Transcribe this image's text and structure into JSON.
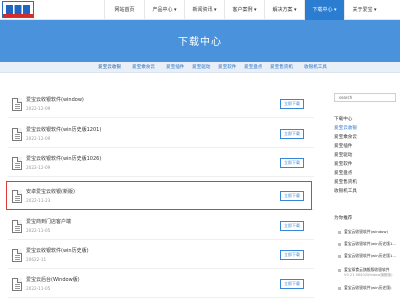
{
  "topnav": {
    "items": [
      "网站首页",
      "产品中心 ▾",
      "新闻资讯 ▾",
      "客户案例 ▾",
      "解决方案 ▾",
      "下载中心 ▾",
      "关于爱宝 ▾"
    ],
    "active_index": 5
  },
  "hero": {
    "title": "下载中心"
  },
  "subnav": {
    "items": [
      "爱宝云收银",
      "爱宝乘食云",
      "爱宝插件",
      "爱宝驱动",
      "爱宝软件",
      "爱宝盘点",
      "爱宝售货机",
      "收银机工具"
    ],
    "active_index": 0
  },
  "downloads": [
    {
      "title": "爱宝云收银软件(window)",
      "date": "2022-12-09",
      "button": "立即下载"
    },
    {
      "title": "爱宝云收银软件(win历史版1201)",
      "date": "2022-12-09",
      "button": "立即下载"
    },
    {
      "title": "爱宝云收银软件(win历史版1026)",
      "date": "2022-12-09",
      "button": "立即下载"
    },
    {
      "title": "安卓爱宝云收银(新版)",
      "date": "2022-11-23",
      "button": "立即下载"
    },
    {
      "title": "爱宝商到门店客户端",
      "date": "2022-11-05",
      "button": "立即下载"
    },
    {
      "title": "爱宝云收银软件(win历史版)",
      "date": "20622-11",
      "button": "立即下载"
    },
    {
      "title": "爱宝云后台(Window版)",
      "date": "2022-11-05",
      "button": "立即下载"
    }
  ],
  "sidebar": {
    "search_placeholder": "search",
    "heading": "下载中心",
    "links": [
      "爱宝云收银",
      "爱宝乘食云",
      "爱宝插件",
      "爱宝驱动",
      "爱宝软件",
      "爱宝盘点",
      "爱宝售货机",
      "收银机工具"
    ],
    "active_index": 0,
    "recommend_heading": "为你推荐",
    "recommend": [
      {
        "title": "爱宝云收银软件(window)",
        "date": ""
      },
      {
        "title": "爱宝云收银软件(win历史版1...",
        "date": ""
      },
      {
        "title": "爱宝云收银软件(win历史版1...",
        "date": ""
      },
      {
        "title": "爱宝乘食云旗舰版收银软件",
        "date": "V0.21.5640(Window旗舰版)"
      },
      {
        "title": "爱宝云收银软件(win历史版)",
        "date": ""
      }
    ]
  },
  "colors": {
    "accent": "#2a7dd0",
    "hero": "#4a93dc",
    "highlight": "#e03b3b"
  }
}
